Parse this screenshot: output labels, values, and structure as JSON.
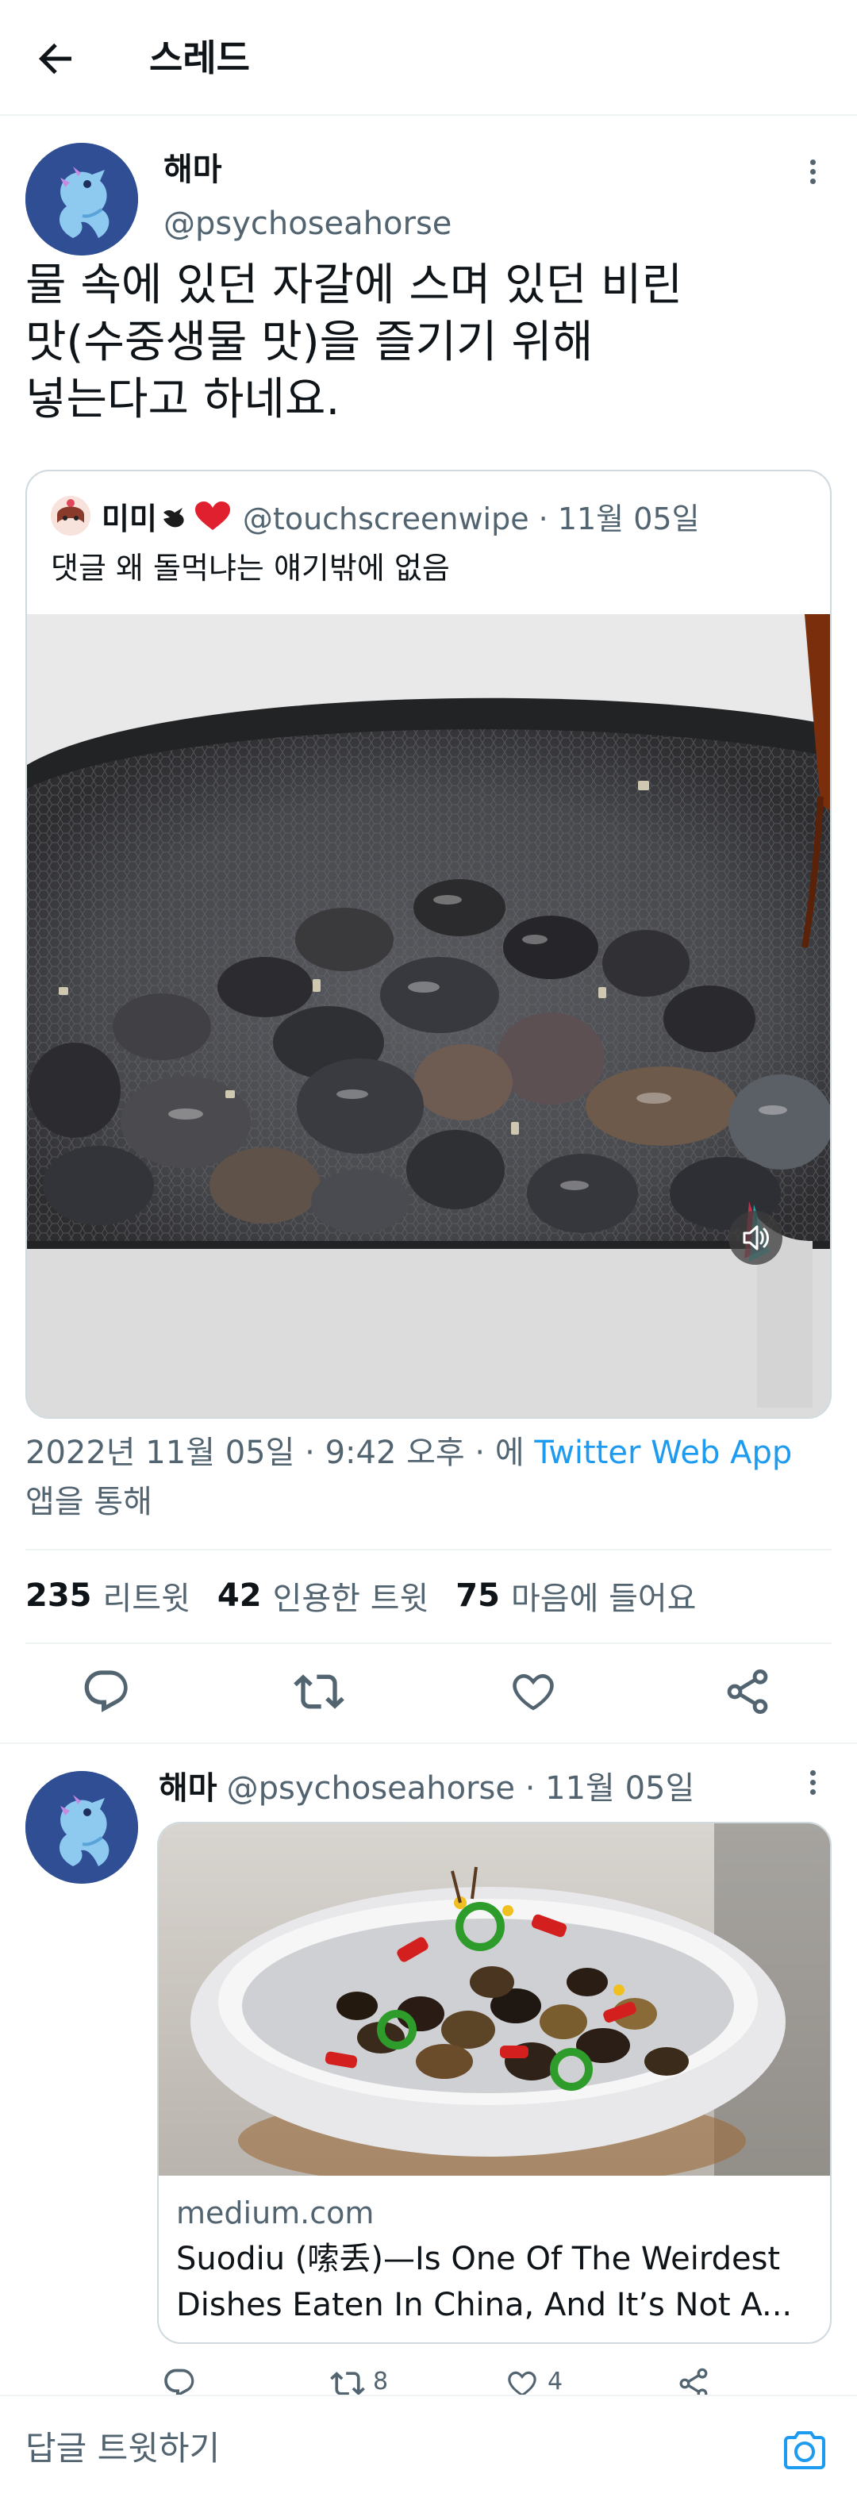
{
  "header": {
    "title": "스레드"
  },
  "main_tweet": {
    "author_name": "해마",
    "author_handle": "@psychoseahorse",
    "text": "물 속에 있던 자갈에 스며 있던 비린\n맛(수중생물 맛)을 즐기기 위해\n넣는다고 하네요.",
    "quoted": {
      "name": "미미",
      "handle_date": "@touchscreenwipe · 11월 05일",
      "text": "댓글 왜 돌먹냐는 얘기밖에 없음"
    },
    "meta_prefix": "2022년 11월 05일 · 9:42 오후 · 에 ",
    "via": "Twitter Web App",
    "meta_suffix": "앱을 통해",
    "stats": {
      "retweets": "235",
      "retweets_label": "리트윗",
      "quotes": "42",
      "quotes_label": "인용한 트윗",
      "likes": "75",
      "likes_label": "마음에 들어요"
    }
  },
  "reply_tweet": {
    "author_name": "해마",
    "handle_date": "@psychoseahorse · 11월 05일",
    "link": {
      "domain": "medium.com",
      "title_line1": "Suodiu (嗦丢)—Is One Of The Weirdest",
      "title_line2": "Dishes Eaten In China, And It’s Not A..."
    },
    "retweet_count": "8",
    "like_count": "4"
  },
  "compose": {
    "placeholder": "답글 트윗하기"
  },
  "colors": {
    "accent": "#1d9bf0",
    "text": "#0f1419",
    "secondary": "#536471",
    "border": "#cfd9de"
  }
}
